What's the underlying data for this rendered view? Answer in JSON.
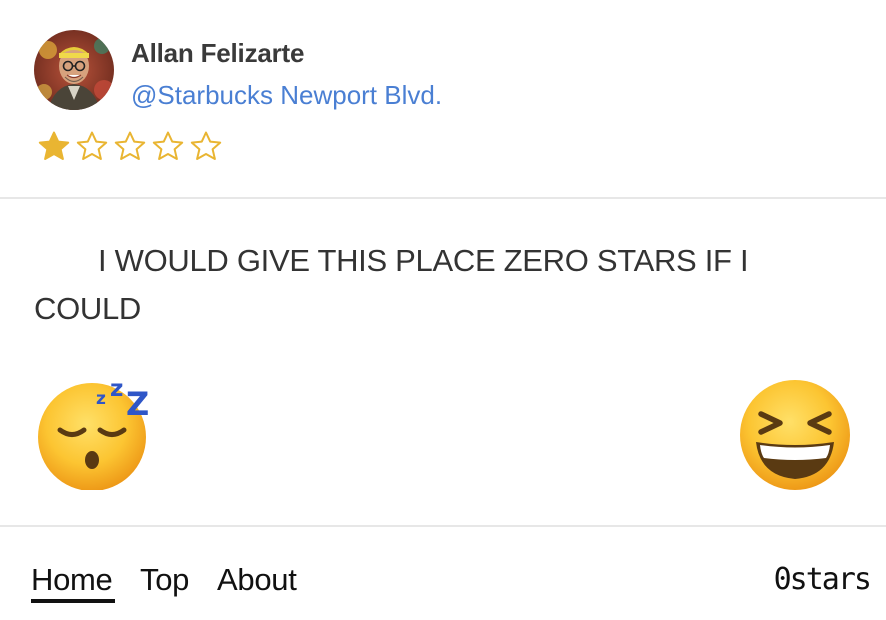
{
  "review": {
    "author": "Allan Felizarte",
    "location": "@Starbucks Newport Blvd.",
    "rating": 1,
    "max_rating": 5,
    "text": "I WOULD GIVE THIS PLACE ZERO STARS IF I COULD",
    "emojis": [
      "sleeping-face",
      "grinning-squinting-face"
    ]
  },
  "colors": {
    "star": "#e9b532",
    "link": "#4a7fd3",
    "divider": "#e7e7e7"
  },
  "nav": {
    "home": "Home",
    "top": "Top",
    "about": "About",
    "active": "Home"
  },
  "stars_count": "0stars"
}
